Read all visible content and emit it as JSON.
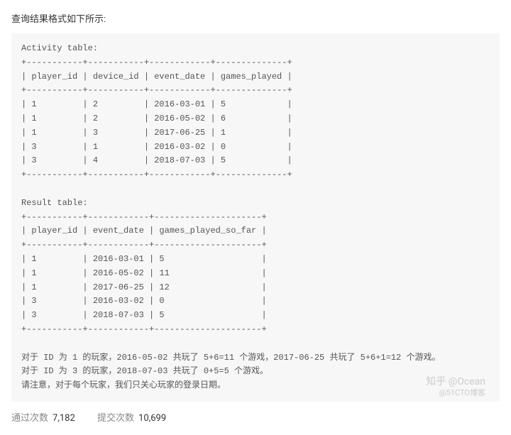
{
  "intro": "查询结果格式如下所示:",
  "code": "Activity table:\n+-----------+-----------+------------+--------------+\n| player_id | device_id | event_date | games_played |\n+-----------+-----------+------------+--------------+\n| 1         | 2         | 2016-03-01 | 5            |\n| 1         | 2         | 2016-05-02 | 6            |\n| 1         | 3         | 2017-06-25 | 1            |\n| 3         | 1         | 2016-03-02 | 0            |\n| 3         | 4         | 2018-07-03 | 5            |\n+-----------+-----------+------------+--------------+\n\nResult table:\n+-----------+------------+---------------------+\n| player_id | event_date | games_played_so_far |\n+-----------+------------+---------------------+\n| 1         | 2016-03-01 | 5                   |\n| 1         | 2016-05-02 | 11                  |\n| 1         | 2017-06-25 | 12                  |\n| 3         | 2016-03-02 | 0                   |\n| 3         | 2018-07-03 | 5                   |\n+-----------+------------+---------------------+\n\n对于 ID 为 1 的玩家，2016-05-02 共玩了 5+6=11 个游戏，2017-06-25 共玩了 5+6+1=12 个游戏。\n对于 ID 为 3 的玩家，2018-07-03 共玩了 0+5=5 个游戏。\n请注意，对于每个玩家，我们只关心玩家的登录日期。",
  "stats": {
    "pass_label": "通过次数",
    "pass_value": "7,182",
    "submit_label": "提交次数",
    "submit_value": "10,699"
  },
  "watermark": {
    "line1": "知乎 @Ocean",
    "line2": "@51CTO博客"
  }
}
